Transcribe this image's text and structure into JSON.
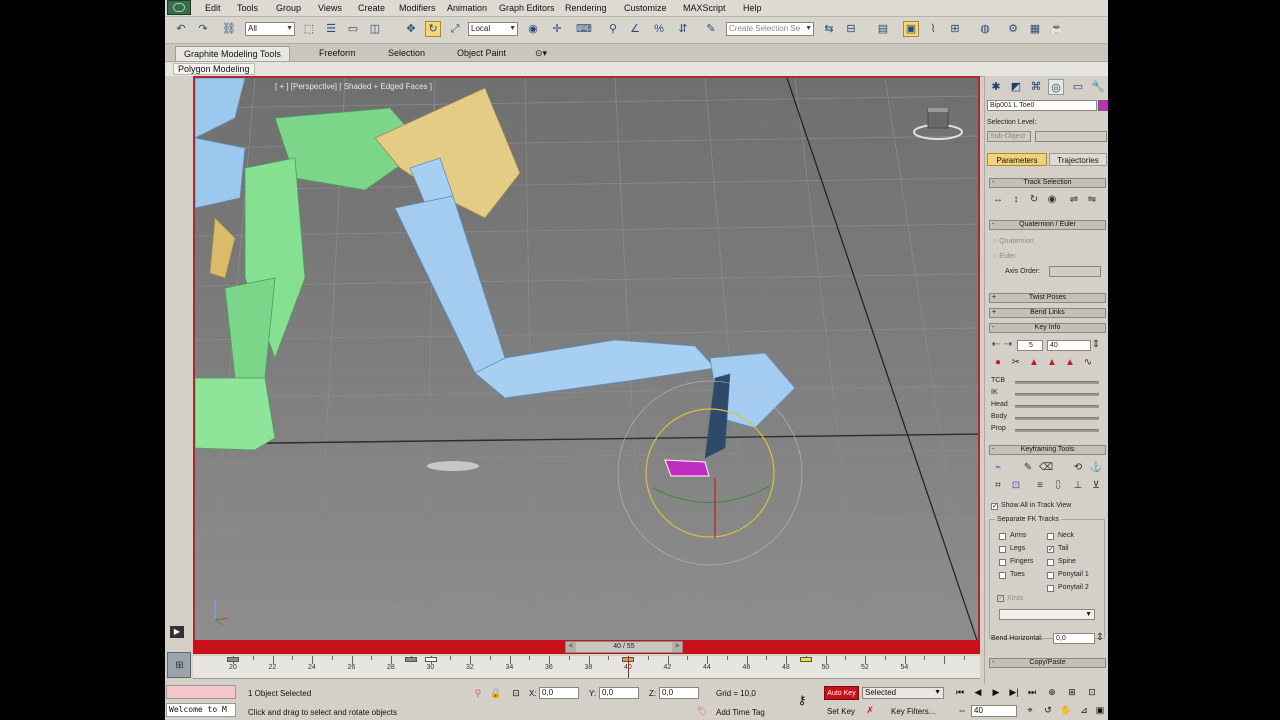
{
  "menubar": {
    "items": [
      "Edit",
      "Tools",
      "Group",
      "Views",
      "Create",
      "Modifiers",
      "Animation",
      "Graph Editors",
      "Rendering",
      "Customize",
      "MAXScript",
      "Help"
    ]
  },
  "toolbar": {
    "filter_value": "All",
    "coord_value": "Local",
    "selection_set_placeholder": "Create Selection Se"
  },
  "ribbon": {
    "tabs": [
      "Graphite Modeling Tools",
      "Freeform",
      "Selection",
      "Object Paint"
    ],
    "active_tab": "Graphite Modeling Tools",
    "panel_label": "Polygon Modeling"
  },
  "viewport": {
    "label": "[ + ] [Perspective] [ Shaded + Edged Faces ]",
    "border_color": "#b0272c"
  },
  "command_panel": {
    "object_name": "Bip001 L Toe0",
    "object_color": "#c02cc0",
    "selection_level_label": "Selection Level:",
    "sub_object_value": "Sub-Object",
    "tabs": [
      "Parameters",
      "Trajectories"
    ],
    "active_tab": "Parameters",
    "rollouts": {
      "track_selection": "Track Selection",
      "quaternion_euler": "Quaternion / Euler",
      "twist_poses": "Twist Poses",
      "bend_links": "Bend Links",
      "key_info": "Key Info",
      "keyframing_tools": "Keyframing Tools",
      "copy_paste": "Copy/Paste"
    },
    "quaternion_option": "Quaternion",
    "euler_option": "Euler",
    "axis_order_label": "Axis Order:",
    "key_number": "5",
    "key_frame": "40",
    "key_info_rows": [
      "TCB",
      "IK",
      "Head",
      "Body",
      "Prop"
    ],
    "show_all_label": "Show All in Track View",
    "separate_fk_label": "Separate FK Tracks",
    "fk_tracks_left": [
      {
        "label": "Arms",
        "checked": false
      },
      {
        "label": "Legs",
        "checked": false
      },
      {
        "label": "Fingers",
        "checked": false
      },
      {
        "label": "Toes",
        "checked": false
      }
    ],
    "fk_tracks_right": [
      {
        "label": "Neck",
        "checked": false
      },
      {
        "label": "Tail",
        "checked": true
      },
      {
        "label": "Spine",
        "checked": false
      },
      {
        "label": "Ponytail 1",
        "checked": false
      },
      {
        "label": "Ponytail 2",
        "checked": false
      }
    ],
    "xtras_label": "Xtras",
    "bend_horizontal_label": "Bend Horizontal:",
    "bend_horizontal_value": "0,0"
  },
  "timeline": {
    "slider_label": "40 / 55",
    "current_frame": 40,
    "tick_labels": [
      "20",
      "22",
      "24",
      "26",
      "28",
      "30",
      "32",
      "34",
      "36",
      "38",
      "40",
      "42",
      "44",
      "46",
      "48",
      "50",
      "52",
      "54"
    ]
  },
  "status": {
    "listener_text": "Welcome to M",
    "selected_text": "1 Object Selected",
    "prompt_text": "Click and drag to select and rotate objects",
    "x_value": "0,0",
    "y_value": "0,0",
    "z_value": "0,0",
    "grid_text": "Grid = 10,0",
    "add_time_tag": "Add Time Tag",
    "auto_key_label": "Auto Key",
    "set_key_label": "Set Key",
    "key_mode_value": "Selected",
    "key_filters_label": "Key Filters...",
    "frame_value": "40"
  }
}
